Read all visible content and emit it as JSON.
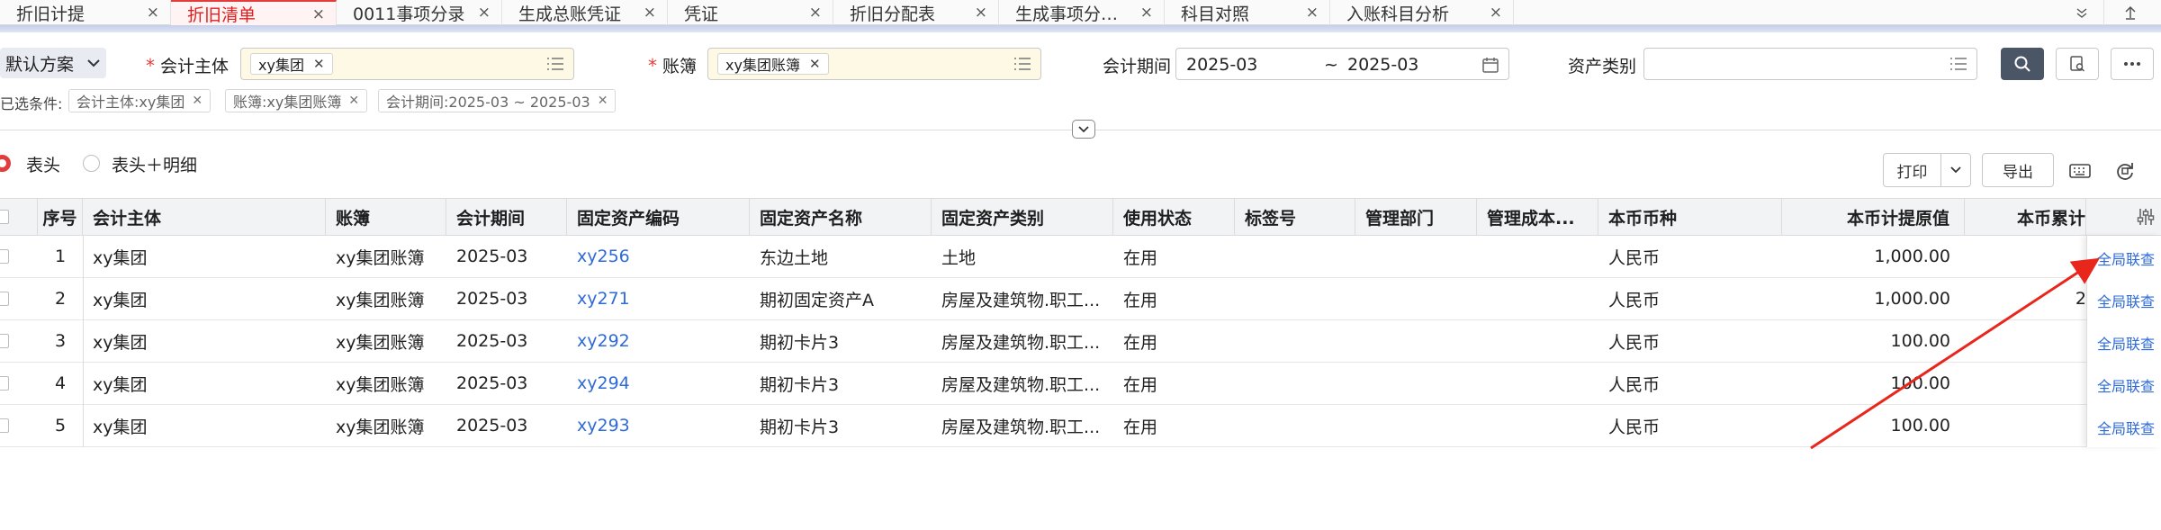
{
  "tabs": [
    {
      "label": "折旧计提"
    },
    {
      "label": "折旧清单"
    },
    {
      "label": "0011事项分录"
    },
    {
      "label": "生成总账凭证"
    },
    {
      "label": "凭证"
    },
    {
      "label": "折旧分配表"
    },
    {
      "label": "生成事项分录..."
    },
    {
      "label": "科目对照"
    },
    {
      "label": "入账科目分析"
    }
  ],
  "tab_close_glyph": "×",
  "filters": {
    "scheme_label": "默认方案",
    "entity_label": "会计主体",
    "entity_chip": "xy集团",
    "book_label": "账簿",
    "book_chip": "xy集团账簿",
    "period_label": "会计期间",
    "period_from": "2025-03",
    "period_sep": "~",
    "period_to": "2025-03",
    "asset_type_label": "资产类别",
    "asset_type_value": ""
  },
  "conditions": {
    "label": "已选条件:",
    "items": [
      "会计主体:xy集团",
      "账簿:xy集团账簿",
      "会计期间:2025-03 ~ 2025-03"
    ]
  },
  "view": {
    "option_header": "表头",
    "option_header_detail": "表头＋明细",
    "print_label": "打印",
    "export_label": "导出"
  },
  "table": {
    "columns": [
      "序号",
      "会计主体",
      "账簿",
      "会计期间",
      "固定资产编码",
      "固定资产名称",
      "固定资产类别",
      "使用状态",
      "标签号",
      "管理部门",
      "管理成本...",
      "本币币种",
      "本币计提原值",
      "本币累计"
    ],
    "rows": [
      {
        "seq": "1",
        "entity": "xy集团",
        "book": "xy集团账簿",
        "period": "2025-03",
        "code": "xy256",
        "name": "东边土地",
        "category": "土地",
        "status": "在用",
        "tag": "",
        "dept": "",
        "cost": "",
        "currency": "人民币",
        "original": "1,000.00",
        "accum": "",
        "action": "全局联查"
      },
      {
        "seq": "2",
        "entity": "xy集团",
        "book": "xy集团账簿",
        "period": "2025-03",
        "code": "xy271",
        "name": "期初固定资产A",
        "category": "房屋及建筑物.职工...",
        "status": "在用",
        "tag": "",
        "dept": "",
        "cost": "",
        "currency": "人民币",
        "original": "1,000.00",
        "accum": "2",
        "action": "全局联查"
      },
      {
        "seq": "3",
        "entity": "xy集团",
        "book": "xy集团账簿",
        "period": "2025-03",
        "code": "xy292",
        "name": "期初卡片3",
        "category": "房屋及建筑物.职工...",
        "status": "在用",
        "tag": "",
        "dept": "",
        "cost": "",
        "currency": "人民币",
        "original": "100.00",
        "accum": "",
        "action": "全局联查"
      },
      {
        "seq": "4",
        "entity": "xy集团",
        "book": "xy集团账簿",
        "period": "2025-03",
        "code": "xy294",
        "name": "期初卡片3",
        "category": "房屋及建筑物.职工...",
        "status": "在用",
        "tag": "",
        "dept": "",
        "cost": "",
        "currency": "人民币",
        "original": "100.00",
        "accum": "",
        "action": "全局联查"
      },
      {
        "seq": "5",
        "entity": "xy集团",
        "book": "xy集团账簿",
        "period": "2025-03",
        "code": "xy293",
        "name": "期初卡片3",
        "category": "房屋及建筑物.职工...",
        "status": "在用",
        "tag": "",
        "dept": "",
        "cost": "",
        "currency": "人民币",
        "original": "100.00",
        "accum": "",
        "action": "全局联查"
      }
    ]
  },
  "colors": {
    "accent_red": "#e23d3d",
    "link_blue": "#2f6bd8",
    "search_button": "#4a5566",
    "annotation_arrow": "#e8261c"
  }
}
